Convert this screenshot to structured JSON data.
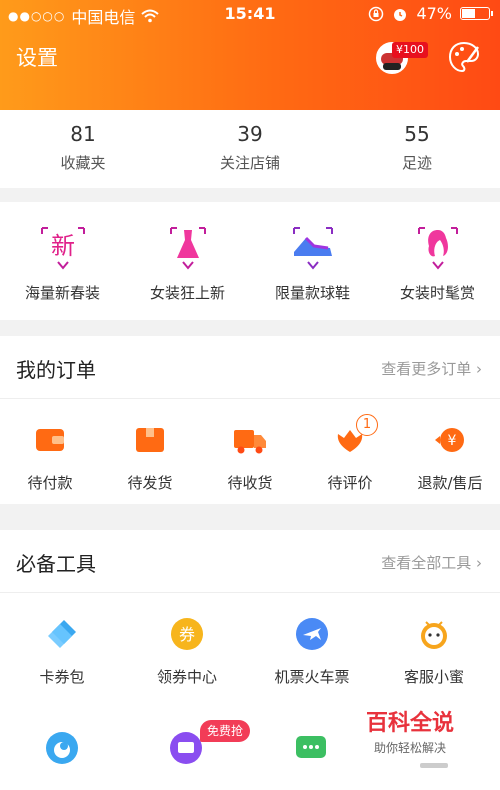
{
  "status": {
    "carrier": "中国电信",
    "time": "15:41",
    "battery": "47%"
  },
  "header": {
    "title": "设置",
    "coupon": "¥100"
  },
  "stats": [
    {
      "num": "81",
      "label": "收藏夹"
    },
    {
      "num": "39",
      "label": "关注店铺"
    },
    {
      "num": "55",
      "label": "足迹"
    }
  ],
  "promos": [
    {
      "label": "海量新春装",
      "icon": "new-icon",
      "glyph": "新"
    },
    {
      "label": "女装狂上新",
      "icon": "dress-icon"
    },
    {
      "label": "限量款球鞋",
      "icon": "sneaker-icon"
    },
    {
      "label": "女装时髦赏",
      "icon": "fashion-icon"
    }
  ],
  "orders": {
    "title": "我的订单",
    "more": "查看更多订单",
    "items": [
      {
        "label": "待付款",
        "icon": "wallet-icon"
      },
      {
        "label": "待发货",
        "icon": "package-icon"
      },
      {
        "label": "待收货",
        "icon": "truck-icon"
      },
      {
        "label": "待评价",
        "icon": "review-icon",
        "badge": "1"
      },
      {
        "label": "退款/售后",
        "icon": "refund-icon",
        "glyph": "¥"
      }
    ]
  },
  "tools": {
    "title": "必备工具",
    "more": "查看全部工具",
    "items": [
      {
        "label": "卡券包",
        "icon": "ticket-icon"
      },
      {
        "label": "领券中心",
        "icon": "coupon-center-icon",
        "glyph": "券"
      },
      {
        "label": "机票火车票",
        "icon": "plane-icon"
      },
      {
        "label": "客服小蜜",
        "icon": "service-icon"
      }
    ],
    "free_badge": "免费抢"
  },
  "watermark": {
    "title": "百科全说",
    "subtitle": "助你轻松解决"
  },
  "colors": {
    "brand_orange": "#ff6a13",
    "accent_red": "#e8101e"
  }
}
